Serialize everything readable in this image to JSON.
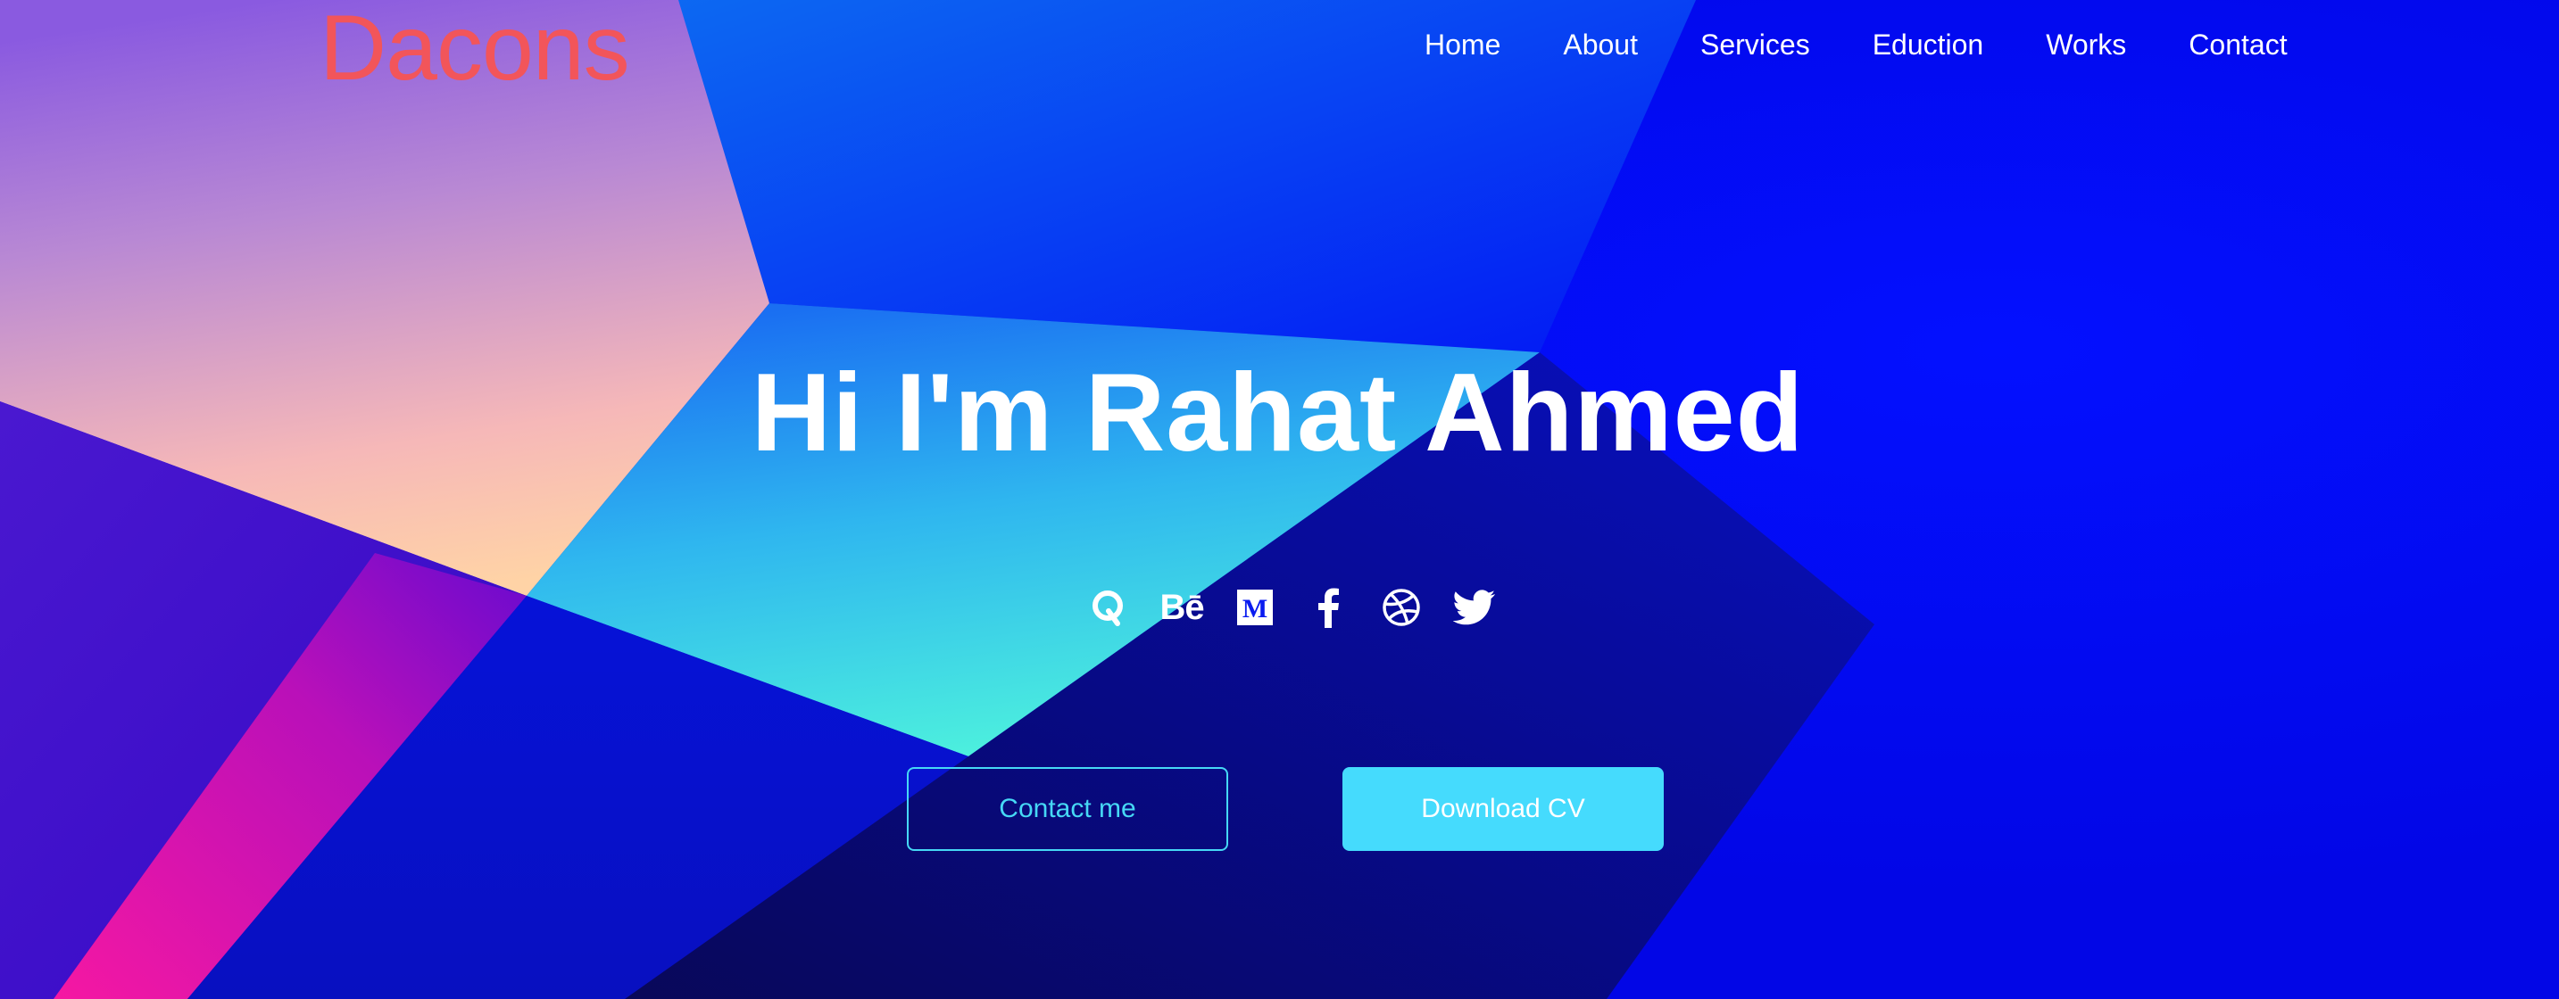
{
  "brand": {
    "logo_text": "Dacons",
    "logo_color": "#f2555a"
  },
  "nav": {
    "items": [
      {
        "label": "Home"
      },
      {
        "label": "About"
      },
      {
        "label": "Services"
      },
      {
        "label": "Eduction"
      },
      {
        "label": "Works"
      },
      {
        "label": "Contact"
      }
    ]
  },
  "hero": {
    "title": "Hi I'm Rahat Ahmed",
    "social_icons": [
      {
        "icon": "quora-icon",
        "glyph": "Q"
      },
      {
        "icon": "behance-icon",
        "glyph": "Bē"
      },
      {
        "icon": "medium-icon",
        "glyph": "M"
      },
      {
        "icon": "facebook-icon",
        "glyph": "f"
      },
      {
        "icon": "dribbble-icon"
      },
      {
        "icon": "twitter-icon"
      }
    ],
    "contact_button_label": "Contact me",
    "download_button_label": "Download CV"
  },
  "colors": {
    "background_blue": "#0008f0",
    "accent_cyan": "#45dbfd",
    "text": "#ffffff"
  }
}
